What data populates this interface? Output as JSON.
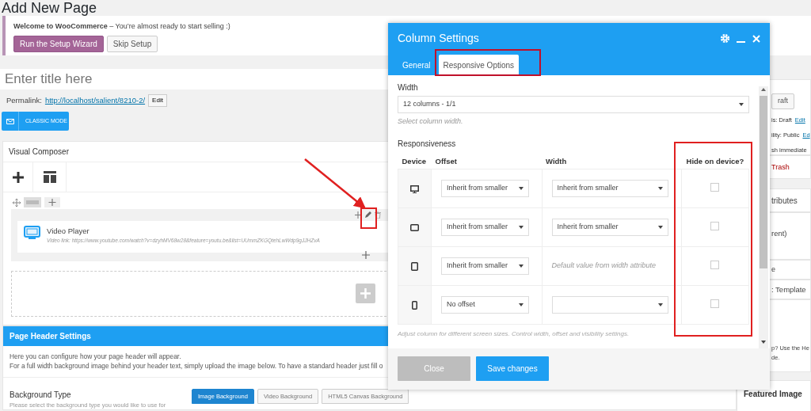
{
  "page_title": "Add New Page",
  "notice": {
    "text": "**Welcome to WooCommerce** – You’re almost ready to start selling :)",
    "buttons": [
      {
        "label": "Run the Setup Wizard",
        "kind": "primary"
      },
      {
        "label": "Skip Setup",
        "kind": "secondary"
      }
    ]
  },
  "title_field": {
    "placeholder": "Enter title here"
  },
  "permalink": {
    "label": "Permalink:",
    "url": "http://localhost/salient/8210-2/",
    "edit": "Edit"
  },
  "classic_mode": "CLASSIC MODE",
  "composer": {
    "title": "Visual Composer",
    "element": {
      "name": "Video Player",
      "detail": "Video link: https://www.youtube.com/watch?v=dzyhMV68w28&feature=youtu.be&list=UUmmZKGQtehLwWdp9gJJHZvA"
    }
  },
  "page_header": {
    "title": "Page Header Settings",
    "lines": [
      "Here you can configure how your page header will appear.",
      "For a full width background image behind your header text, simply upload the image below. To have a standard header just fill o"
    ],
    "background_label": "Background Type",
    "background_hint": "Please select the background type you would like to use for",
    "options": [
      {
        "label": "Image Background",
        "selected": true
      },
      {
        "label": "Video Background",
        "selected": false
      },
      {
        "label": "HTML5 Canvas Background",
        "selected": false
      }
    ]
  },
  "sidebar": {
    "draft_button": "raft",
    "status": "is: Draft",
    "status_edit": "Edit",
    "visibility": "ility: Public",
    "visibility_edit": "Ed",
    "publish": "sh immediate",
    "trash": "Trash",
    "attributes": "tributes",
    "parent": "rent)",
    "template_label": "e",
    "template": ": Template",
    "help": "p? Use the He",
    "help_2": "de.",
    "featured": "Featured Image"
  },
  "modal": {
    "title": "Column Settings",
    "tabs": [
      {
        "label": "General",
        "selected": false
      },
      {
        "label": "Responsive Options",
        "selected": true
      }
    ],
    "width_label": "Width",
    "width_value": "12 columns - 1/1",
    "width_hint": "Select column width.",
    "responsiveness_label": "Responsiveness",
    "columns": [
      "Device",
      "Offset",
      "Width",
      "Hide on device?"
    ],
    "rows": [
      {
        "kind": "desktop",
        "offset": "Inherit from smaller",
        "width": "Inherit from smaller",
        "hidden": false
      },
      {
        "kind": "tablet-landscape",
        "offset": "Inherit from smaller",
        "width": "Inherit from smaller",
        "hidden": false
      },
      {
        "kind": "tablet-portrait",
        "offset": "Inherit from smaller",
        "width_note": "Default value from width attribute",
        "hidden": false
      },
      {
        "kind": "phone",
        "offset": "No offset",
        "width": "",
        "hidden": false
      }
    ],
    "note": "Adjust column for different screen sizes. Control width, offset and visibility settings.",
    "buttons": [
      {
        "label": "Close",
        "kind": "secondary"
      },
      {
        "label": "Save changes",
        "kind": "primary"
      }
    ]
  }
}
